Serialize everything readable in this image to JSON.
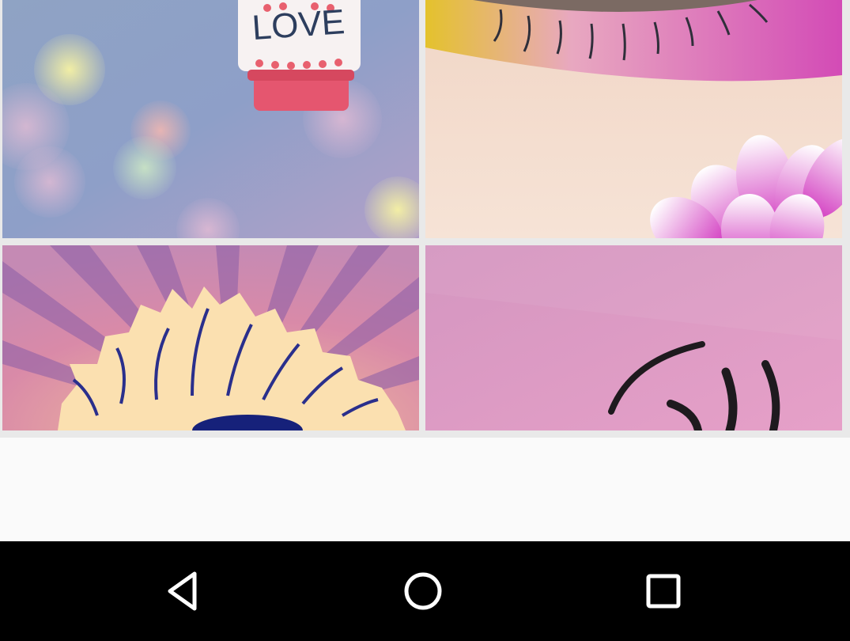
{
  "gallery": {
    "tiles": [
      {
        "label": "LOVE",
        "subject": "glitter-bottle-bokeh"
      },
      {
        "subject": "pink-eye-makeup-flower"
      },
      {
        "subject": "pop-art-flower-rays"
      },
      {
        "subject": "eyelash-on-pink"
      }
    ]
  },
  "navbar": {
    "back_icon": "back-triangle-icon",
    "home_icon": "home-circle-icon",
    "recents_icon": "recents-square-icon",
    "color": "#000000",
    "icon_color": "#ffffff"
  }
}
